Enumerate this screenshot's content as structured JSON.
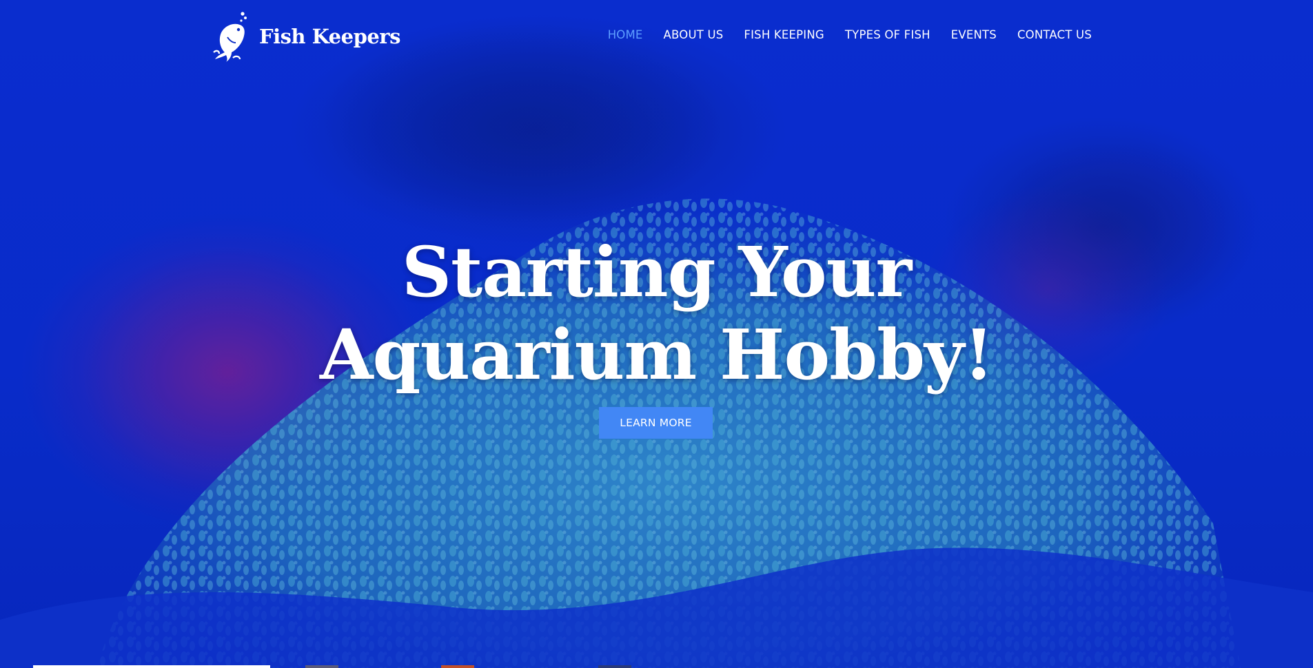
{
  "brand": {
    "name": "Fish Keepers",
    "icon": "jumping-fish-icon"
  },
  "nav": {
    "items": [
      {
        "label": "HOME",
        "active": true
      },
      {
        "label": "ABOUT US",
        "active": false
      },
      {
        "label": "FISH KEEPING",
        "active": false
      },
      {
        "label": "TYPES OF FISH",
        "active": false
      },
      {
        "label": "EVENTS",
        "active": false
      },
      {
        "label": "CONTACT US",
        "active": false
      }
    ]
  },
  "hero": {
    "headline_line1": "Starting Your",
    "headline_line2": "Aquarium Hobby!",
    "cta_label": "LEARN MORE",
    "background": "blue-tinted coral reef photo"
  },
  "slider": {
    "slides": 4,
    "active_slide": 1
  },
  "colors": {
    "tint": "#0a2cc4",
    "accent": "#4287f5",
    "active_nav": "#5fa0ff",
    "text": "#ffffff"
  }
}
